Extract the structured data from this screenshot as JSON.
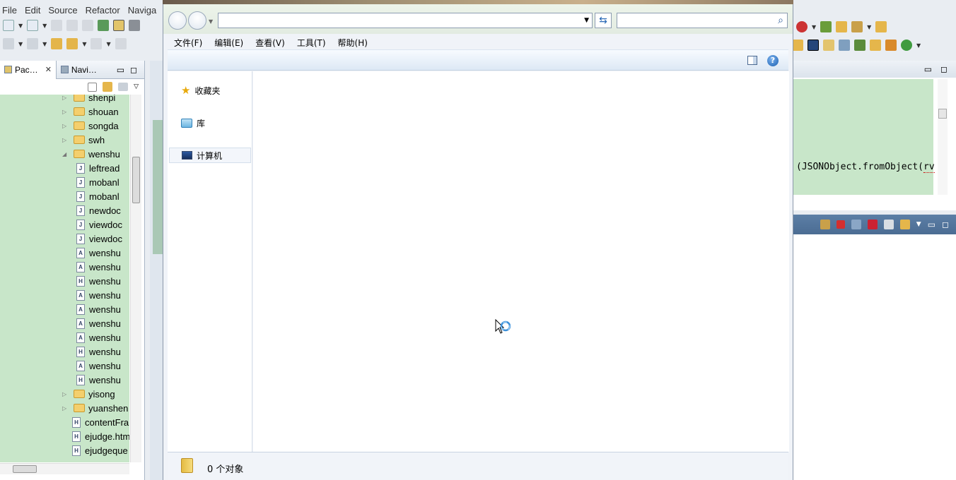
{
  "eclipse": {
    "menu": [
      "File",
      "Edit",
      "Source",
      "Refactor",
      "Naviga"
    ],
    "package_tabs": [
      {
        "label": "Pac…",
        "active": true,
        "closable": true
      },
      {
        "label": "Navi…",
        "active": false,
        "closable": false
      }
    ],
    "tree": [
      {
        "label": "shenpi",
        "type": "folder",
        "level": 0,
        "expanded": false
      },
      {
        "label": "shouan",
        "type": "folder",
        "level": 0,
        "expanded": false
      },
      {
        "label": "songda",
        "type": "folder",
        "level": 0,
        "expanded": false
      },
      {
        "label": "swh",
        "type": "folder",
        "level": 0,
        "expanded": false
      },
      {
        "label": "wenshu",
        "type": "folder",
        "level": 0,
        "expanded": true
      },
      {
        "label": "leftread",
        "type": "js",
        "level": 1
      },
      {
        "label": "mobanl",
        "type": "js",
        "level": 1
      },
      {
        "label": "mobanl",
        "type": "js",
        "level": 1
      },
      {
        "label": "newdoc",
        "type": "js",
        "level": 1
      },
      {
        "label": "viewdoc",
        "type": "js",
        "level": 1
      },
      {
        "label": "viewdoc",
        "type": "js",
        "level": 1
      },
      {
        "label": "wenshu",
        "type": "jsp",
        "level": 1
      },
      {
        "label": "wenshu",
        "type": "jsp",
        "level": 1
      },
      {
        "label": "wenshu",
        "type": "html",
        "level": 1
      },
      {
        "label": "wenshu",
        "type": "jsp",
        "level": 1
      },
      {
        "label": "wenshu",
        "type": "jsp",
        "level": 1
      },
      {
        "label": "wenshu",
        "type": "jsp",
        "level": 1
      },
      {
        "label": "wenshu",
        "type": "jsp",
        "level": 1
      },
      {
        "label": "wenshu",
        "type": "html",
        "level": 1
      },
      {
        "label": "wenshu",
        "type": "jsp",
        "level": 1
      },
      {
        "label": "wenshu",
        "type": "html",
        "level": 1
      },
      {
        "label": "yisong",
        "type": "folder",
        "level": 0,
        "expanded": false
      },
      {
        "label": "yuanshen",
        "type": "folder",
        "level": 0,
        "expanded": false
      },
      {
        "label": "contentFra",
        "type": "html",
        "level": 0
      },
      {
        "label": "ejudge.htm",
        "type": "html",
        "level": 0
      },
      {
        "label": "ejudgeque",
        "type": "html",
        "level": 0
      }
    ],
    "code_snippet": "(JSONObject.fromObject(",
    "code_snippet_underlined": "rv"
  },
  "explorer": {
    "address_value": "",
    "search_placeholder": "",
    "menu": [
      "文件(F)",
      "编辑(E)",
      "查看(V)",
      "工具(T)",
      "帮助(H)"
    ],
    "help_glyph": "?",
    "nav_items": [
      {
        "label": "收藏夹",
        "icon": "star-icon",
        "selected": false
      },
      {
        "label": "库",
        "icon": "library-icon",
        "selected": false
      },
      {
        "label": "计算机",
        "icon": "computer-icon",
        "selected": true
      }
    ],
    "status_text": "0 个对象"
  },
  "colors": {
    "tree_highlight": "#c8e6c9",
    "explorer_bg": "#f0f3f8",
    "console_header": "#4b6c93"
  }
}
